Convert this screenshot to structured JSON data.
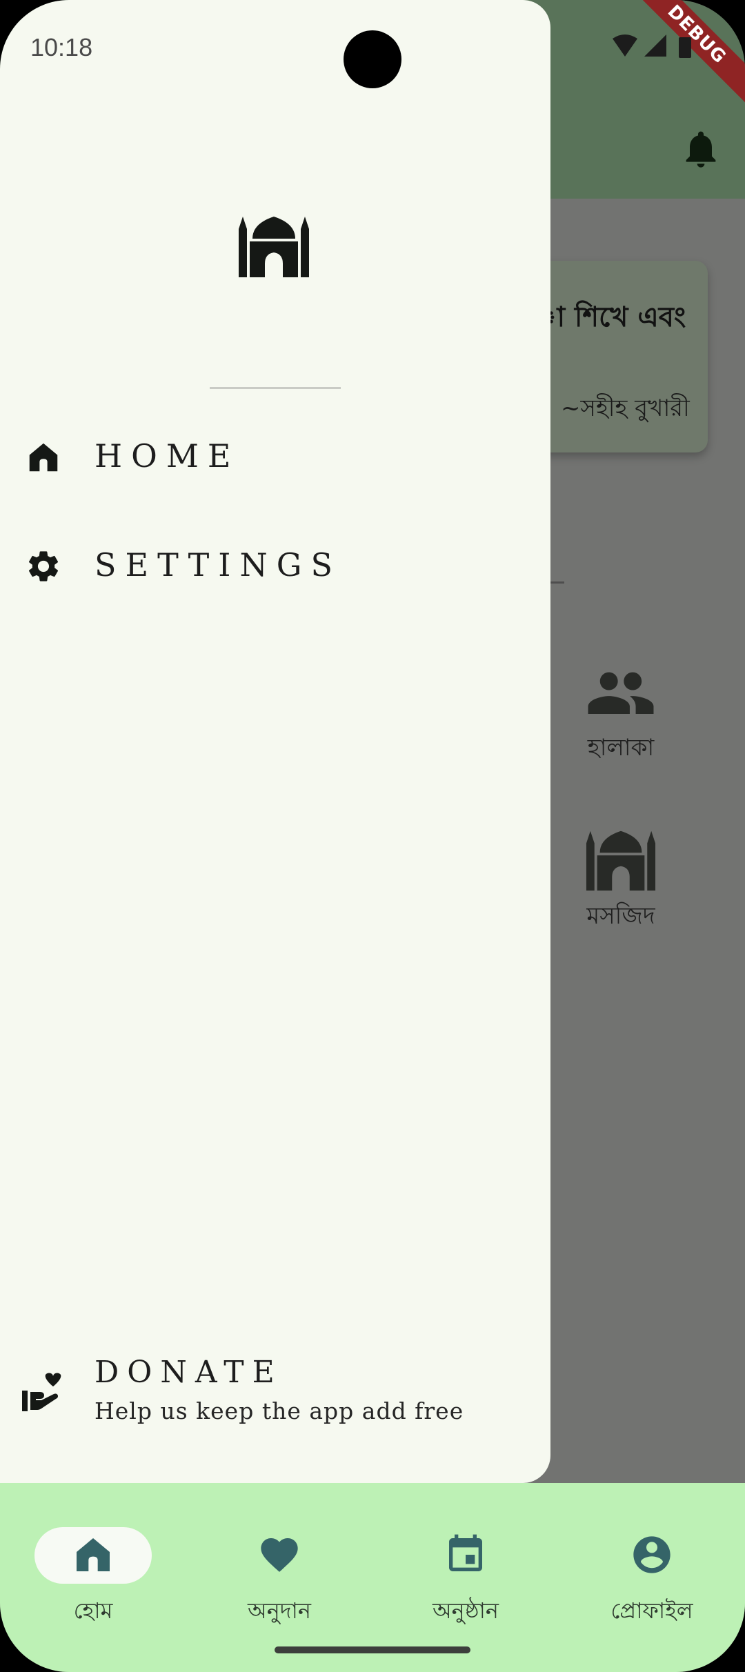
{
  "status_bar": {
    "time": "10:18",
    "debug_banner": "DEBUG"
  },
  "background": {
    "quote_text": "া শিখে এবং",
    "quote_source": "~সহীহ বুখারী",
    "grid": [
      {
        "label": "হালাকা",
        "icon": "people-icon"
      },
      {
        "label": "মসজিদ",
        "icon": "mosque-icon"
      }
    ]
  },
  "drawer": {
    "logo_icon": "mosque-icon",
    "menu": [
      {
        "label": "HOME",
        "icon": "home-icon"
      },
      {
        "label": "SETTINGS",
        "icon": "gear-icon"
      }
    ],
    "donate": {
      "title": "DONATE",
      "subtitle": "Help us keep the app add free",
      "icon": "donate-icon"
    }
  },
  "bottom_nav": {
    "items": [
      {
        "label": "হোম",
        "icon": "home-icon",
        "active": true
      },
      {
        "label": "অনুদান",
        "icon": "heart-icon",
        "active": false
      },
      {
        "label": "অনুষ্ঠান",
        "icon": "calendar-icon",
        "active": false
      },
      {
        "label": "প্রোফাইল",
        "icon": "account-circle-icon",
        "active": false
      }
    ]
  },
  "colors": {
    "drawer_bg": "#f6f9f0",
    "appbar": "#597359",
    "scrim": "#727371",
    "bottom_nav_bg": "#bdf1b5",
    "nav_icon": "#356468",
    "debug_ribbon": "#8f2424"
  }
}
